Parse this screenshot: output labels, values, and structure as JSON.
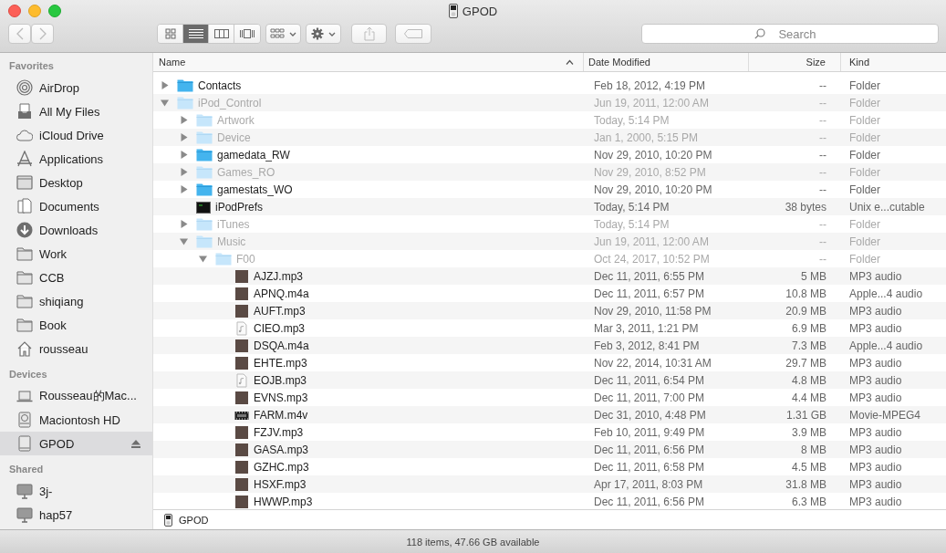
{
  "window": {
    "title": "GPOD"
  },
  "toolbar": {
    "back_disabled": true,
    "forward_disabled": true,
    "views": [
      {
        "kind": "icons",
        "selected": false
      },
      {
        "kind": "list",
        "selected": true
      },
      {
        "kind": "columns",
        "selected": false
      },
      {
        "kind": "coverflow",
        "selected": false
      }
    ],
    "search": {
      "placeholder": "Search"
    }
  },
  "sidebar": {
    "sections": [
      {
        "title": "Favorites",
        "items": [
          {
            "label": "AirDrop",
            "kind": "airdrop",
            "selected": false
          },
          {
            "label": "All My Files",
            "kind": "allfiles",
            "selected": false
          },
          {
            "label": "iCloud Drive",
            "kind": "cloud",
            "selected": false
          },
          {
            "label": "Applications",
            "kind": "apps",
            "selected": false
          },
          {
            "label": "Desktop",
            "kind": "desktop",
            "selected": false
          },
          {
            "label": "Documents",
            "kind": "documents",
            "selected": false
          },
          {
            "label": "Downloads",
            "kind": "downloads",
            "selected": false
          },
          {
            "label": "Work",
            "kind": "folder",
            "selected": false
          },
          {
            "label": "CCB",
            "kind": "folder",
            "selected": false
          },
          {
            "label": "shiqiang",
            "kind": "folder",
            "selected": false
          },
          {
            "label": "Book",
            "kind": "folder",
            "selected": false
          },
          {
            "label": "rousseau",
            "kind": "home",
            "selected": false
          }
        ]
      },
      {
        "title": "Devices",
        "items": [
          {
            "label": "Rousseau的Mac...",
            "kind": "laptop",
            "selected": false
          },
          {
            "label": "Maciontosh HD",
            "kind": "disk",
            "selected": false
          },
          {
            "label": "GPOD",
            "kind": "drive",
            "selected": true,
            "eject": true
          }
        ]
      },
      {
        "title": "Shared",
        "items": [
          {
            "label": "3j-",
            "kind": "monitor",
            "selected": false
          },
          {
            "label": "hap57",
            "kind": "monitor",
            "selected": false
          }
        ]
      }
    ]
  },
  "table": {
    "columns": [
      {
        "label": "Name",
        "sorted": true
      },
      {
        "label": "Date Modified",
        "sorted": false
      },
      {
        "label": "Size",
        "sorted": false
      },
      {
        "label": "Kind",
        "sorted": false
      }
    ],
    "rows": [
      {
        "name": "Contacts",
        "kind": "folder",
        "hidden": false,
        "expanded": false,
        "date": "Feb 18, 2012, 4:19 PM",
        "size": "--",
        "kind_label": "Folder"
      },
      {
        "name": "iPod_Control",
        "kind": "folder",
        "hidden": true,
        "expanded": true,
        "date": "Jun 19, 2011, 12:00 AM",
        "size": "--",
        "kind_label": "Folder",
        "children": [
          {
            "name": "Artwork",
            "kind": "folder",
            "hidden": true,
            "expanded": false,
            "date": "Today, 5:14 PM",
            "size": "--",
            "kind_label": "Folder"
          },
          {
            "name": "Device",
            "kind": "folder",
            "hidden": true,
            "expanded": false,
            "date": "Jan 1, 2000, 5:15 PM",
            "size": "--",
            "kind_label": "Folder"
          },
          {
            "name": "gamedata_RW",
            "kind": "folder",
            "hidden": false,
            "expanded": false,
            "date": "Nov 29, 2010, 10:20 PM",
            "size": "--",
            "kind_label": "Folder"
          },
          {
            "name": "Games_RO",
            "kind": "folder",
            "hidden": true,
            "expanded": false,
            "date": "Nov 29, 2010, 8:52 PM",
            "size": "--",
            "kind_label": "Folder"
          },
          {
            "name": "gamestats_WO",
            "kind": "folder",
            "hidden": false,
            "expanded": false,
            "date": "Nov 29, 2010, 10:20 PM",
            "size": "--",
            "kind_label": "Folder"
          },
          {
            "name": "iPodPrefs",
            "kind": "exec",
            "hidden": false,
            "date": "Today, 5:14 PM",
            "size": "38 bytes",
            "kind_label": "Unix e...cutable"
          },
          {
            "name": "iTunes",
            "kind": "folder",
            "hidden": true,
            "expanded": false,
            "date": "Today, 5:14 PM",
            "size": "--",
            "kind_label": "Folder"
          },
          {
            "name": "Music",
            "kind": "folder",
            "hidden": true,
            "expanded": true,
            "date": "Jun 19, 2011, 12:00 AM",
            "size": "--",
            "kind_label": "Folder",
            "children": [
              {
                "name": "F00",
                "kind": "folder",
                "hidden": true,
                "expanded": true,
                "date": "Oct 24, 2017, 10:52 PM",
                "size": "--",
                "kind_label": "Folder",
                "children": [
                  {
                    "name": "AJZJ.mp3",
                    "kind": "art",
                    "hidden": false,
                    "date": "Dec 11, 2011, 6:55 PM",
                    "size": "5 MB",
                    "kind_label": "MP3 audio"
                  },
                  {
                    "name": "APNQ.m4a",
                    "kind": "art",
                    "hidden": false,
                    "date": "Dec 11, 2011, 6:57 PM",
                    "size": "10.8 MB",
                    "kind_label": "Apple...4 audio"
                  },
                  {
                    "name": "AUFT.mp3",
                    "kind": "art",
                    "hidden": false,
                    "date": "Nov 29, 2010, 11:58 PM",
                    "size": "20.9 MB",
                    "kind_label": "MP3 audio"
                  },
                  {
                    "name": "CIEO.mp3",
                    "kind": "note",
                    "hidden": false,
                    "date": "Mar 3, 2011, 1:21 PM",
                    "size": "6.9 MB",
                    "kind_label": "MP3 audio"
                  },
                  {
                    "name": "DSQA.m4a",
                    "kind": "art",
                    "hidden": false,
                    "date": "Feb 3, 2012, 8:41 PM",
                    "size": "7.3 MB",
                    "kind_label": "Apple...4 audio"
                  },
                  {
                    "name": "EHTE.mp3",
                    "kind": "art",
                    "hidden": false,
                    "date": "Nov 22, 2014, 10:31 AM",
                    "size": "29.7 MB",
                    "kind_label": "MP3 audio"
                  },
                  {
                    "name": "EOJB.mp3",
                    "kind": "note",
                    "hidden": false,
                    "date": "Dec 11, 2011, 6:54 PM",
                    "size": "4.8 MB",
                    "kind_label": "MP3 audio"
                  },
                  {
                    "name": "EVNS.mp3",
                    "kind": "art",
                    "hidden": false,
                    "date": "Dec 11, 2011, 7:00 PM",
                    "size": "4.4 MB",
                    "kind_label": "MP3 audio"
                  },
                  {
                    "name": "FARM.m4v",
                    "kind": "video",
                    "hidden": false,
                    "date": "Dec 31, 2010, 4:48 PM",
                    "size": "1.31 GB",
                    "kind_label": "Movie-MPEG4"
                  },
                  {
                    "name": "FZJV.mp3",
                    "kind": "art",
                    "hidden": false,
                    "date": "Feb 10, 2011, 9:49 PM",
                    "size": "3.9 MB",
                    "kind_label": "MP3 audio"
                  },
                  {
                    "name": "GASA.mp3",
                    "kind": "art",
                    "hidden": false,
                    "date": "Dec 11, 2011, 6:56 PM",
                    "size": "8 MB",
                    "kind_label": "MP3 audio"
                  },
                  {
                    "name": "GZHC.mp3",
                    "kind": "art",
                    "hidden": false,
                    "date": "Dec 11, 2011, 6:58 PM",
                    "size": "4.5 MB",
                    "kind_label": "MP3 audio"
                  },
                  {
                    "name": "HSXF.mp3",
                    "kind": "art",
                    "hidden": false,
                    "date": "Apr 17, 2011, 8:03 PM",
                    "size": "31.8 MB",
                    "kind_label": "MP3 audio"
                  },
                  {
                    "name": "HWWP.mp3",
                    "kind": "art",
                    "hidden": false,
                    "date": "Dec 11, 2011, 6:56 PM",
                    "size": "6.3 MB",
                    "kind_label": "MP3 audio"
                  }
                ]
              }
            ]
          }
        ]
      }
    ]
  },
  "path_bar": {
    "label": "GPOD"
  },
  "status_bar": "118 items, 47.66 GB available"
}
